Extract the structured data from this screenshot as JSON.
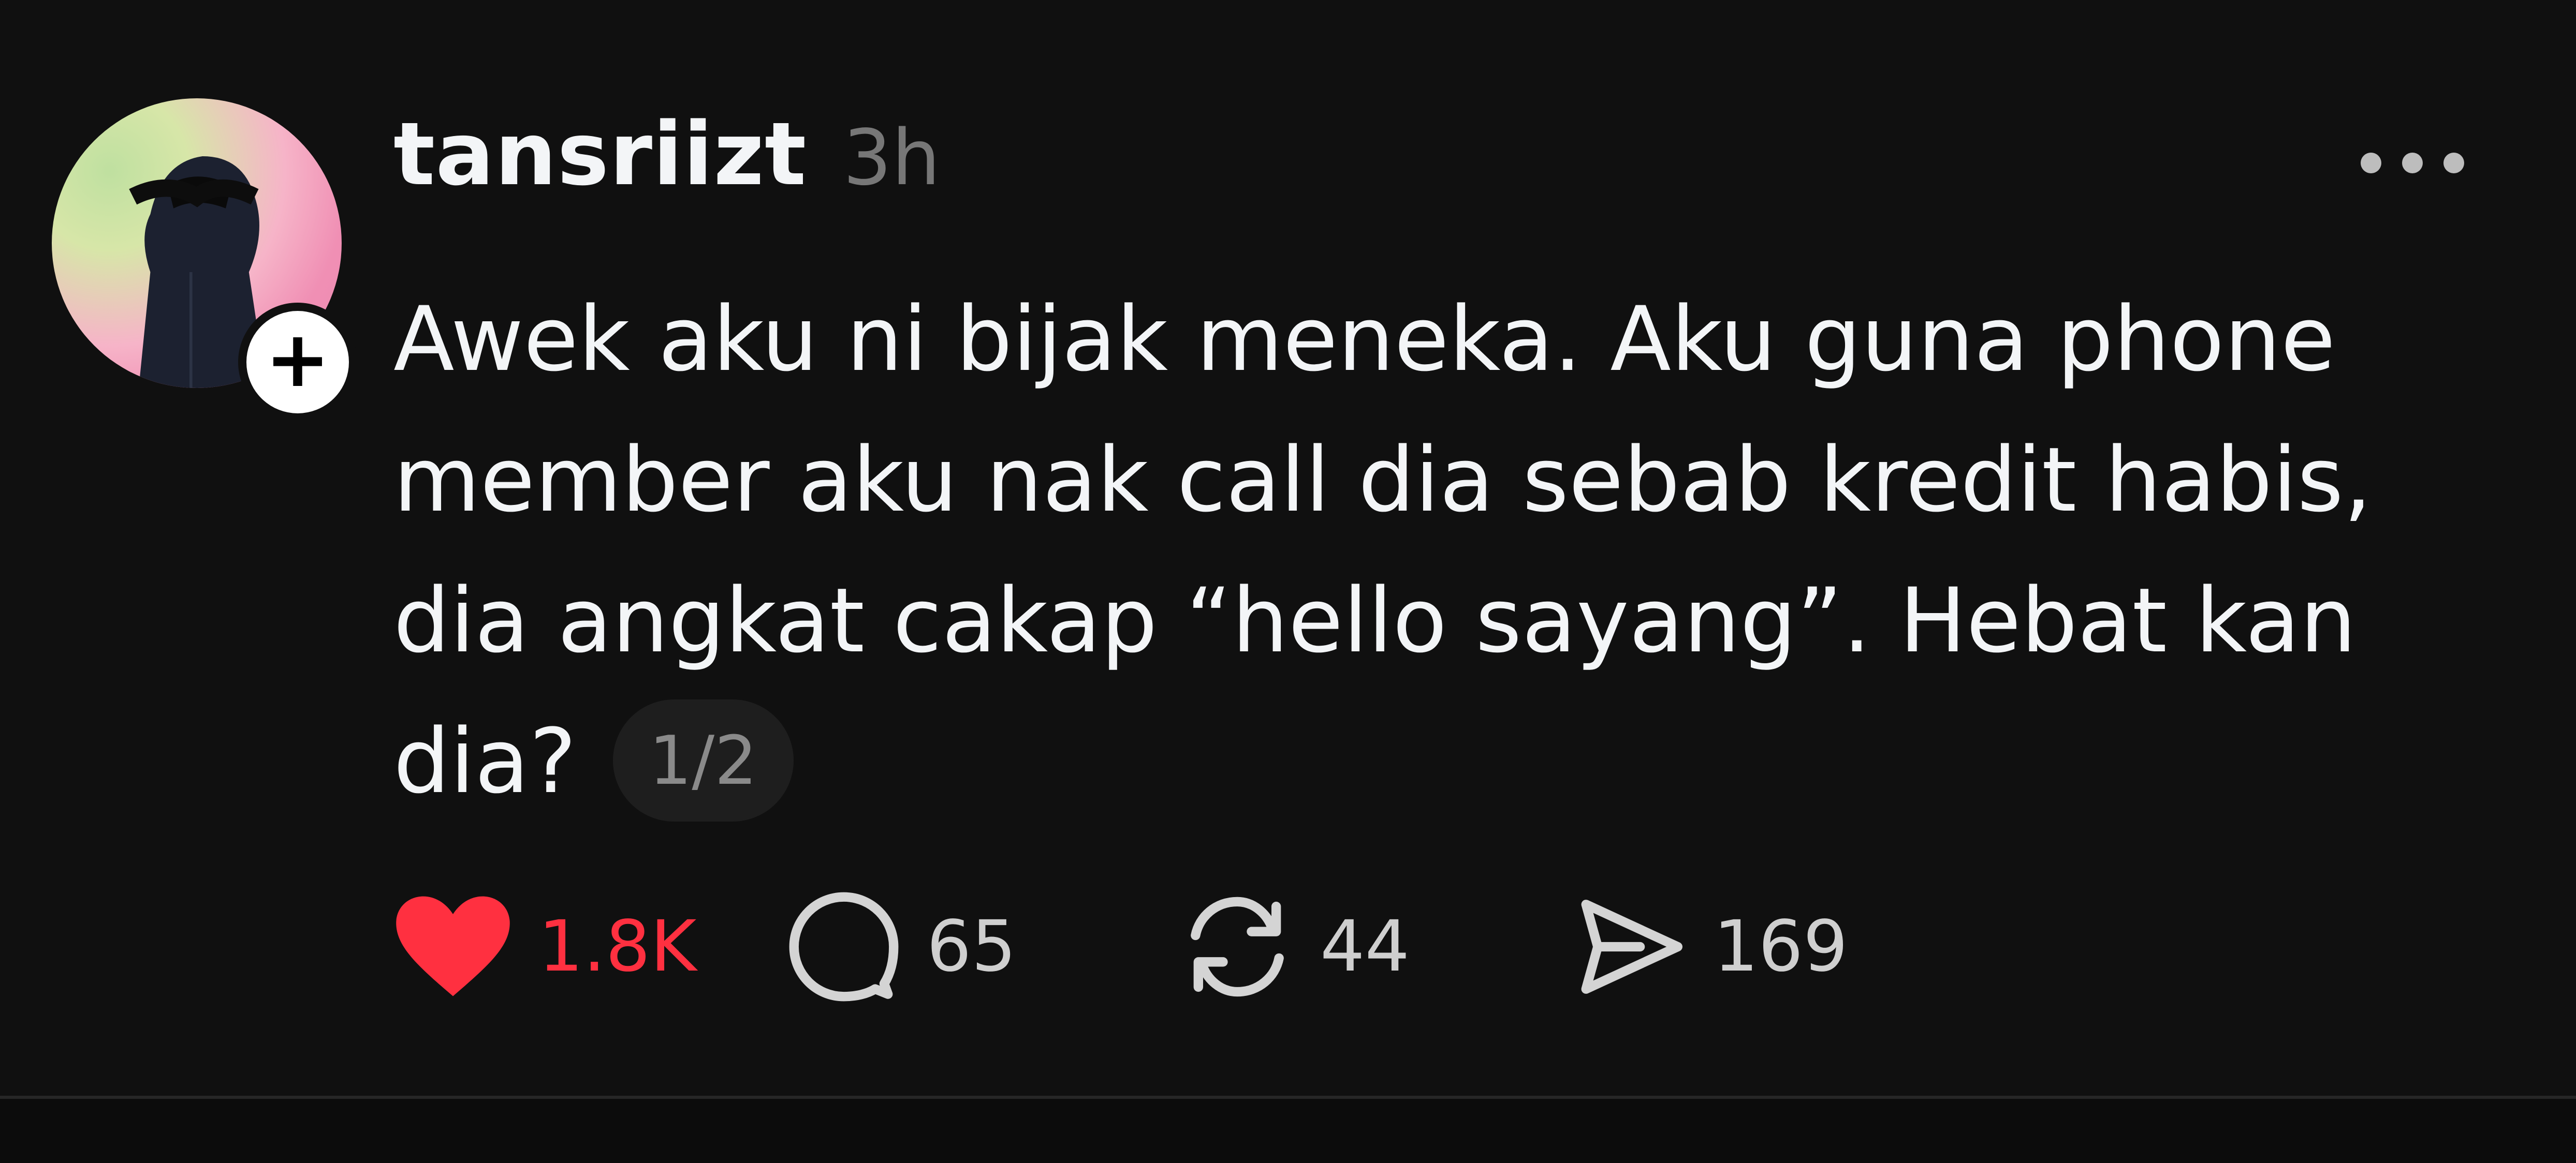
{
  "post": {
    "username": "tansriizt",
    "time": "3h",
    "text_lines": [
      "Awek aku ni bijak meneka. Aku guna phone",
      "member aku nak call dia sebab kredit habis,",
      "dia angkat cakap “hello sayang”. Hebat kan",
      "dia?"
    ],
    "pager": "1/2",
    "follow_badge": "+",
    "actions": {
      "likes": "1.8K",
      "replies": "65",
      "reposts": "44",
      "shares": "169"
    },
    "liked": true,
    "icons": {
      "like": "heart-icon",
      "reply": "comment-bubble-icon",
      "repost": "repost-arrows-icon",
      "share": "send-icon",
      "more": "more-dots-icon"
    },
    "colors": {
      "background": "#101010",
      "text": "#f3f5f7",
      "muted": "#777777",
      "like_red": "#ff3040"
    }
  }
}
